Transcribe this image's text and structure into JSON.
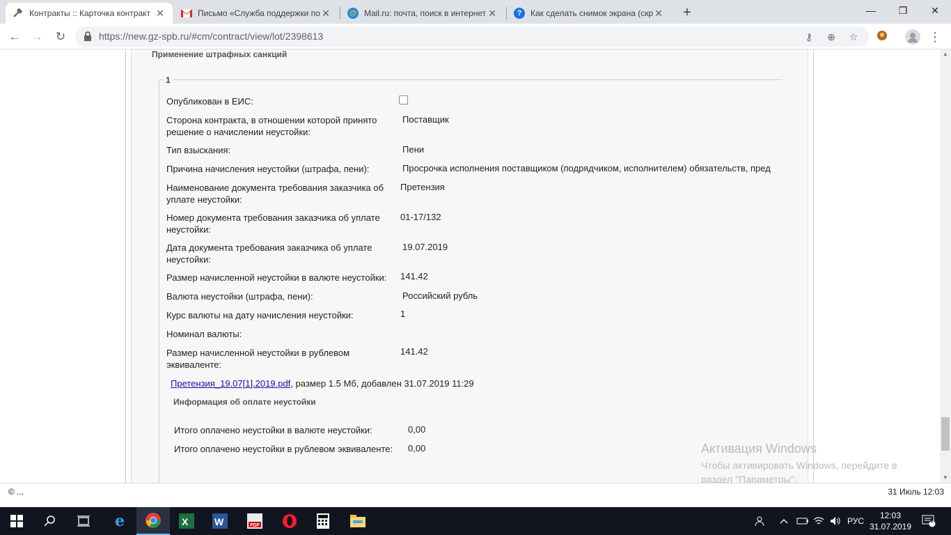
{
  "browser": {
    "tabs": [
      {
        "title": "Контракты :: Карточка контракт",
        "icon": "hammer-icon",
        "active": true
      },
      {
        "title": "Письмо «Служба поддержки по",
        "icon": "gmail-icon",
        "active": false
      },
      {
        "title": "Mail.ru: почта, поиск в интернет",
        "icon": "mailru-icon",
        "active": false
      },
      {
        "title": "Как сделать снимок экрана (скр",
        "icon": "globe-icon",
        "active": false
      }
    ],
    "url": "https://new.gz-spb.ru/#cm/contract/view/lot/2398613"
  },
  "page": {
    "section_title": "Применение штрафных санкций",
    "legend": "1",
    "fields": [
      {
        "label": "Опубликован в ЕИС:",
        "value": ""
      },
      {
        "label": "Сторона контракта, в отношении которой принято решение о начислении неустойки:",
        "value": "Поставщик"
      },
      {
        "label": "Тип взыскания:",
        "value": "Пени"
      },
      {
        "label": "Причина начисления неустойки (штрафа, пени):",
        "value": "Просрочка исполнения поставщиком (подрядчиком, исполнителем) обязательств, пред"
      },
      {
        "label": "Наименование документа требования заказчика об уплате неустойки:",
        "value": "Претензия"
      },
      {
        "label": "Номер документа требования заказчика об уплате неустойки:",
        "value": "01-17/132"
      },
      {
        "label": "Дата документа требования заказчика об уплате неустойки:",
        "value": "19.07.2019"
      },
      {
        "label": "Размер начисленной неустойки в валюте неустойки:",
        "value": "141.42"
      },
      {
        "label": "Валюта неустойки (штрафа, пени):",
        "value": "Российский рубль"
      },
      {
        "label": "Курс валюты на дату начисления неустойки:",
        "value": "1"
      },
      {
        "label": "Номинал валюты:",
        "value": ""
      },
      {
        "label": "Размер начисленной неустойки в рублевом эквиваленте:",
        "value": "141.42"
      }
    ],
    "file": {
      "name": "Претензия_19.07[1].2019.pdf",
      "info": ", размер 1.5 Мб, добавлен 31.07.2019 11:29"
    },
    "payment_title": "Информация об оплате неустойки",
    "payments": [
      {
        "label": "Итого оплачено неустойки в валюте неустойки:",
        "value": "0,00"
      },
      {
        "label": "Итого оплачено неустойки в рублевом эквиваленте:",
        "value": "0,00"
      }
    ]
  },
  "watermark": {
    "title": "Активация Windows",
    "text": "Чтобы активировать Windows, перейдите в раздел \"Параметры\"."
  },
  "status": {
    "left": "© ...",
    "right": "31 Июль 12:03"
  },
  "taskbar": {
    "lang": "РУС",
    "time": "12:03",
    "date": "31.07.2019",
    "notif_count": "1"
  }
}
